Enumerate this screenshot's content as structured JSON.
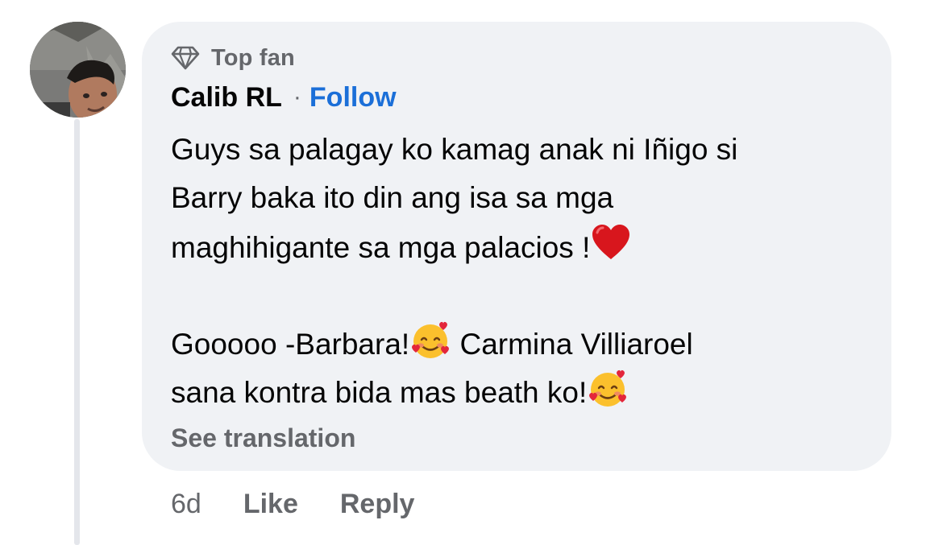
{
  "comment": {
    "badge": {
      "icon": "diamond-icon",
      "label": "Top fan"
    },
    "author": {
      "name": "Calib RL",
      "separator": "·",
      "follow_label": "Follow"
    },
    "avatar": {
      "icon": "profile-photo"
    },
    "body": {
      "line1": "Guys sa palagay ko kamag anak ni Iñigo si",
      "line2": "Barry baka ito din ang isa sa mga",
      "line3": "maghihigante sa mga  palacios !",
      "line3_emoji": "red-heart-emoji",
      "line4a": "Gooooo -Barbara!",
      "line4_emoji": "smiling-face-with-hearts-emoji",
      "line4b": " Carmina Villiaroel",
      "line5": "sana kontra bida mas beath ko!",
      "line5_emoji": "smiling-face-with-hearts-emoji"
    },
    "see_translation_label": "See translation",
    "actions": {
      "time": "6d",
      "like_label": "Like",
      "reply_label": "Reply"
    }
  },
  "colors": {
    "bubble_bg": "#f0f2f5",
    "text_primary": "#050505",
    "text_secondary": "#65676b",
    "link_blue": "#1b6fd8",
    "thread_line": "#e4e6eb"
  }
}
